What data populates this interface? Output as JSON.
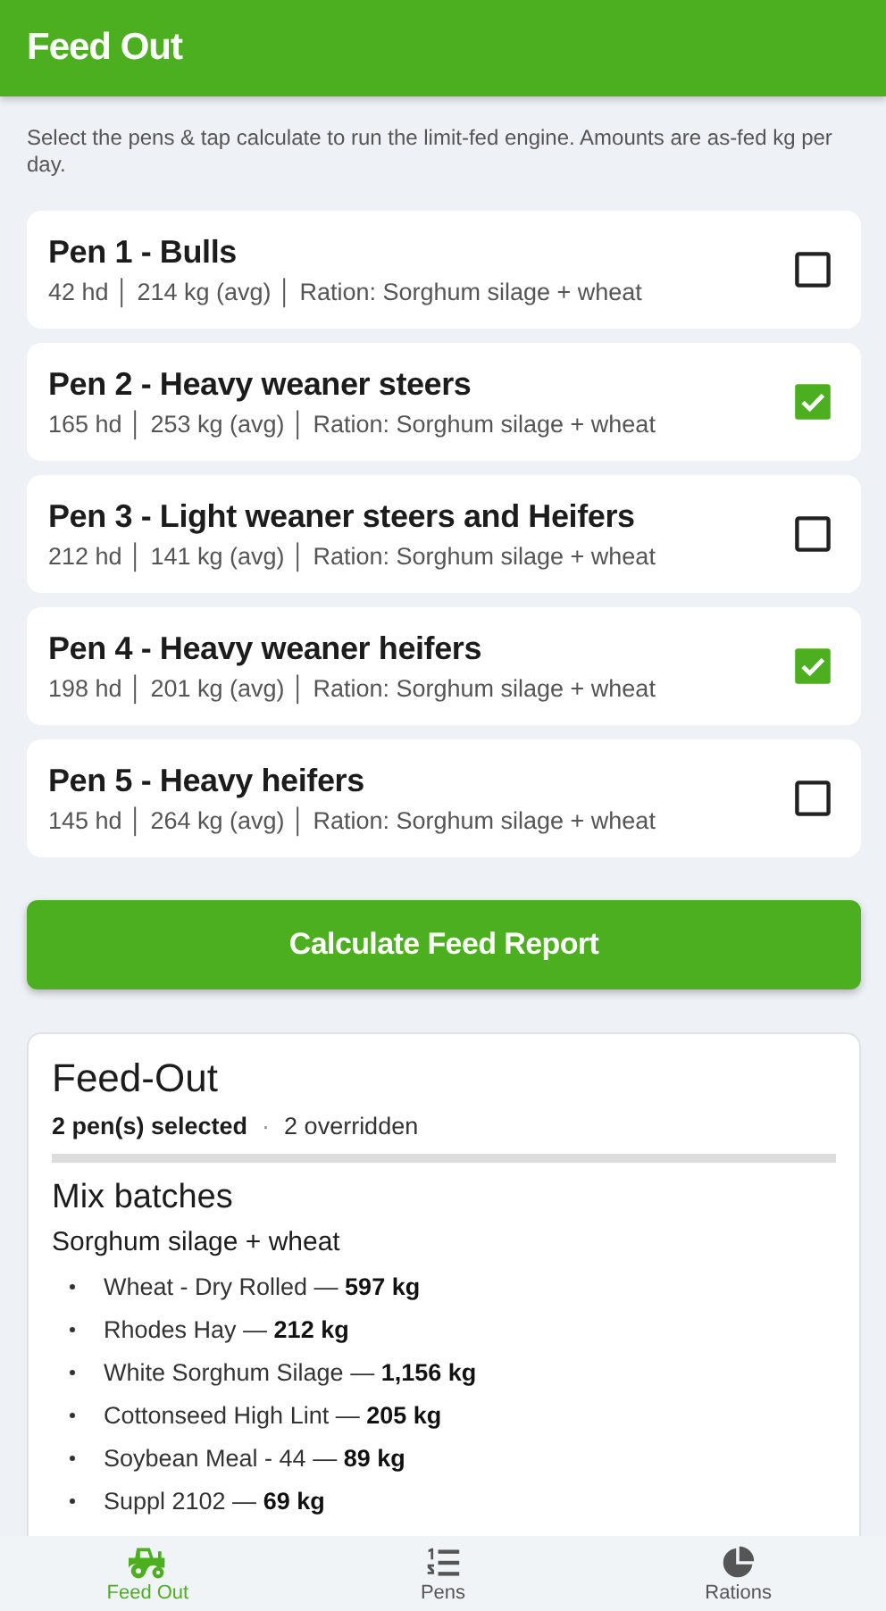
{
  "app_bar": {
    "title": "Feed Out"
  },
  "intro": "Select the pens & tap calculate to run the limit-fed engine. Amounts are as-fed kg per day.",
  "pens": [
    {
      "name": "Pen 1 - Bulls",
      "details": "42 hd │ 214 kg (avg) │ Ration: Sorghum silage + wheat",
      "selected": false
    },
    {
      "name": "Pen 2 - Heavy weaner steers",
      "details": "165 hd │ 253 kg (avg) │ Ration: Sorghum silage + wheat",
      "selected": true
    },
    {
      "name": "Pen 3 - Light weaner steers and Heifers",
      "details": "212 hd │ 141 kg (avg) │ Ration: Sorghum silage + wheat",
      "selected": false
    },
    {
      "name": "Pen 4 - Heavy weaner heifers",
      "details": "198 hd │ 201 kg (avg) │ Ration: Sorghum silage + wheat",
      "selected": true
    },
    {
      "name": "Pen 5 - Heavy heifers",
      "details": "145 hd │ 264 kg (avg) │ Ration: Sorghum silage + wheat",
      "selected": false
    }
  ],
  "calculate_button": "Calculate Feed Report",
  "report": {
    "title": "Feed-Out",
    "selected_count": "2 pen(s) selected",
    "separator": "·",
    "overridden": "2 overridden",
    "section_title": "Mix batches",
    "batches": [
      {
        "ration": "Sorghum silage + wheat",
        "items": [
          "Wheat - Dry Rolled — **597 kg**",
          "Rhodes Hay — **212 kg**",
          "White Sorghum Silage — **1,156 kg**",
          "Cottonseed High Lint — **205 kg**",
          "Soybean Meal - 44 — **89 kg**",
          "Suppl 2102 — **69 kg**"
        ]
      }
    ]
  },
  "bottom_nav": [
    {
      "label": "Feed Out",
      "kind": "tractor",
      "selected": true
    },
    {
      "label": "Pens",
      "kind": "list",
      "selected": false
    },
    {
      "label": "Rations",
      "kind": "pie",
      "selected": false
    }
  ]
}
